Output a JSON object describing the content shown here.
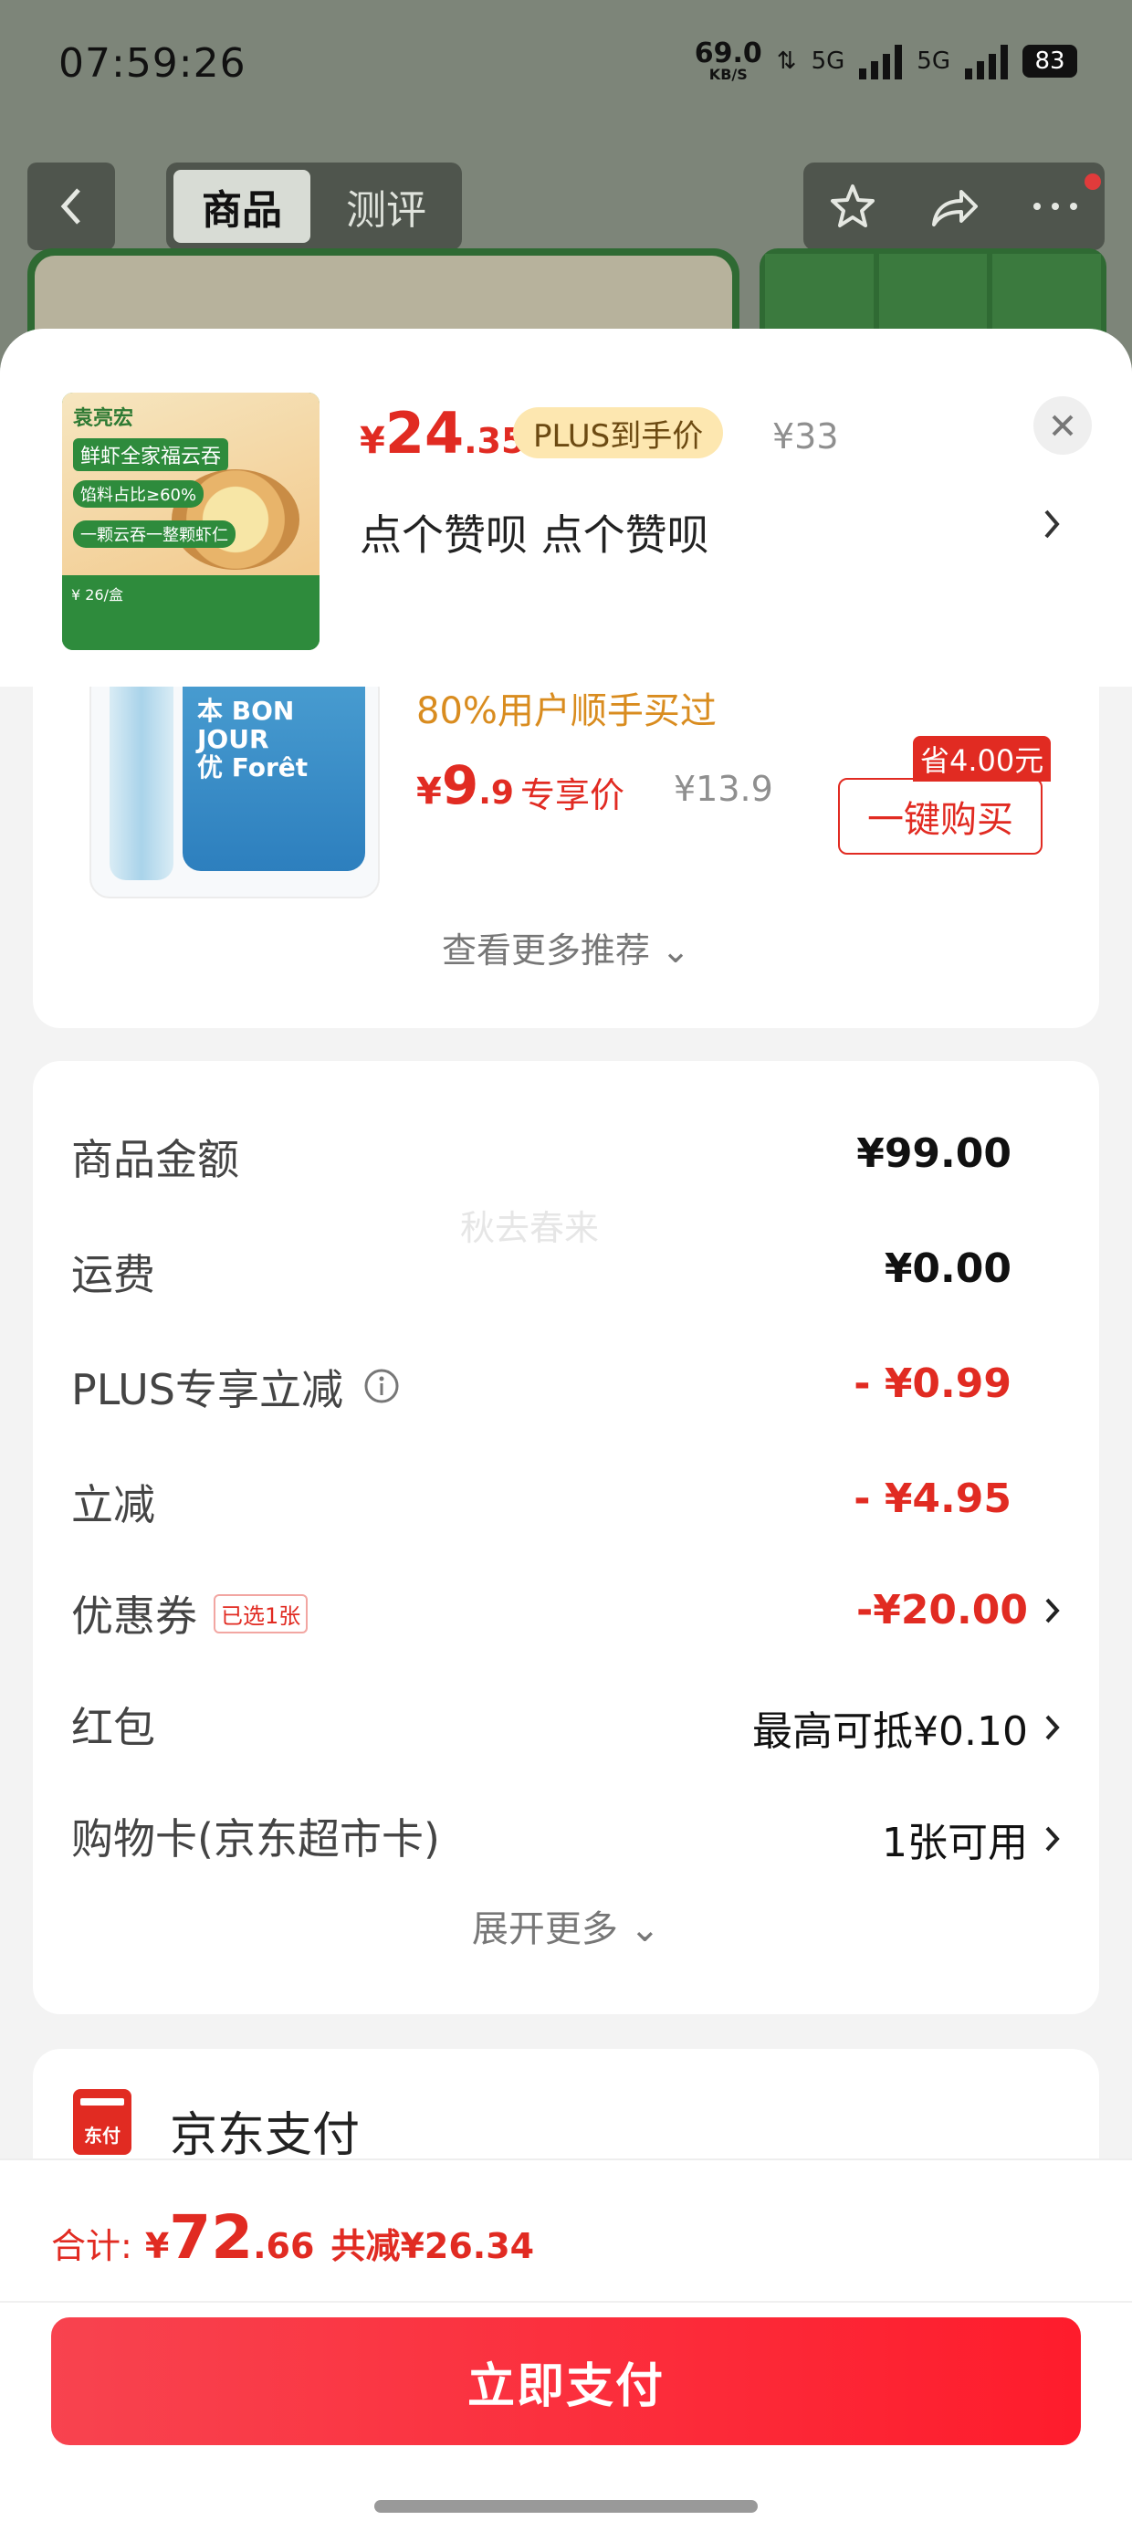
{
  "status_bar": {
    "time": "07:59:26",
    "net_speed": "69.0",
    "net_unit": "KB/S",
    "sig1_label": "5G",
    "sig2_label": "5G",
    "battery": "83"
  },
  "nav": {
    "tab_product": "商品",
    "tab_review": "测评"
  },
  "product": {
    "price_currency": "¥",
    "price_int": "24",
    "price_dec": ".35",
    "plus_badge": "PLUS到手价",
    "original_price": "¥33",
    "spec": "点个赞呗  点个赞呗",
    "thumb_brand": "袁亮宏",
    "thumb_title": "鲜虾全家福云吞",
    "thumb_tag1": "馅料占比≥60%",
    "thumb_tag2": "一颗云吞一整颗虾仁",
    "thumb_price": "¥ 26/盒"
  },
  "recommend": {
    "bought_text": "80%用户顺手买过",
    "price_currency": "¥",
    "price_int": "9",
    "price_dec": ".9",
    "price_tag": "专享价",
    "original_price": "¥13.9",
    "save_badge": "省4.00元",
    "buy_button": "一键购买",
    "see_more": "查看更多推荐 ⌄",
    "pack_text": "本 BON\nJOUR\n优 Forêt"
  },
  "fees": {
    "watermark": "秋去春来",
    "rows": [
      {
        "label": "商品金额",
        "value": "¥99.00"
      },
      {
        "label": "运费",
        "value": "¥0.00"
      },
      {
        "label": "PLUS专享立减",
        "value": "- ¥0.99"
      },
      {
        "label": "立减",
        "value": "- ¥4.95"
      },
      {
        "label": "优惠券",
        "chip": "已选1张",
        "value": "-¥20.00"
      },
      {
        "label": "红包",
        "value": "最高可抵¥0.10"
      },
      {
        "label": "购物卡(京东超市卡)",
        "value": "1张可用"
      }
    ],
    "expand_more": "展开更多 ⌄"
  },
  "payment": {
    "icon_text": "东付",
    "label": "京东支付"
  },
  "footer": {
    "total_label": "合计:",
    "total_currency": "¥",
    "total_int": "72",
    "total_dec": ".66",
    "total_saved": "共减¥26.34",
    "pay_button": "立即支付"
  },
  "colors": {
    "accent_red": "#e12b22",
    "plus_gold": "#fde7b0",
    "recommend_orange": "#d98c1f"
  }
}
